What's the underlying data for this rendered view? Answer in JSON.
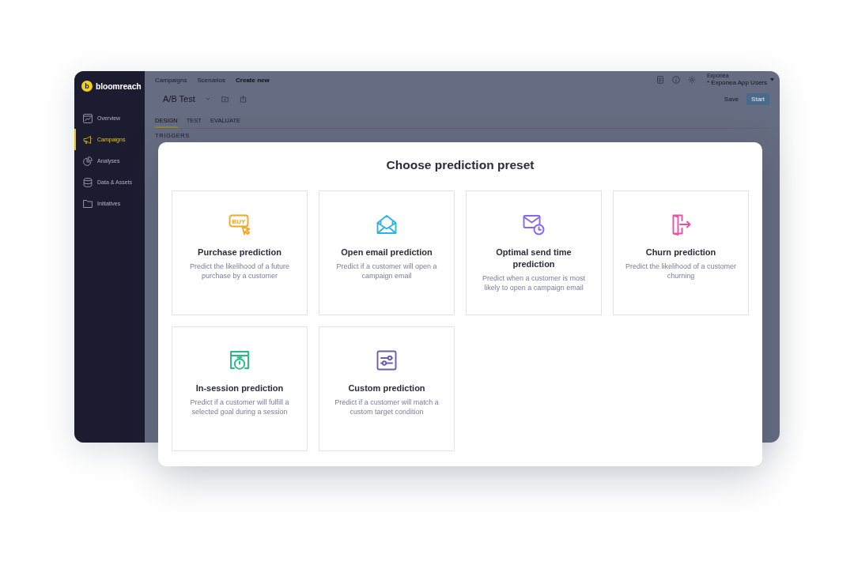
{
  "sidebar": {
    "logo_mark": "b",
    "logo": "bloomreach",
    "items": [
      {
        "kind": "overview",
        "label": "Overview",
        "selected": false
      },
      {
        "kind": "campaigns",
        "label": "Campaigns",
        "selected": true
      },
      {
        "kind": "analyses",
        "label": "Analyses",
        "selected": false
      },
      {
        "kind": "data",
        "label": "Data & Assets",
        "selected": false
      },
      {
        "kind": "initiatives",
        "label": "Initiatives",
        "selected": false
      }
    ]
  },
  "header": {
    "breadcrumbs": [
      {
        "label": "Campaigns",
        "current": false
      },
      {
        "label": "Scenarios",
        "current": false
      },
      {
        "label": "Create new",
        "current": true
      }
    ],
    "title": "A/B Test",
    "project_select": {
      "label": "Exponea",
      "value": "* Exponea App Users"
    },
    "buttons": [
      {
        "kind": "text",
        "label": "Save"
      },
      {
        "kind": "primary",
        "label": "Start"
      }
    ]
  },
  "tabs": [
    {
      "label": "DESIGN",
      "selected": true
    },
    {
      "label": "TEST",
      "selected": false
    },
    {
      "label": "EVALUATE",
      "selected": false
    }
  ],
  "section_label": "TRIGGERS",
  "modal": {
    "title": "Choose prediction preset",
    "presets": [
      {
        "kind": "buy",
        "icon_text": "BUY",
        "color": "#f5a623",
        "title": "Purchase prediction",
        "description": "Predict the likelihood of a future purchase by a customer"
      },
      {
        "kind": "open-email",
        "color": "#2fb4e0",
        "title": "Open email prediction",
        "description": "Predict if a customer will open a campaign email"
      },
      {
        "kind": "send-time",
        "color": "#8467f0",
        "title": "Optimal send time prediction",
        "description": "Predict when a customer is most likely to open a campaign email"
      },
      {
        "kind": "churn",
        "color": "#ec4ea7",
        "title": "Churn prediction",
        "description": "Predict the likelihood of a customer churning"
      },
      {
        "kind": "session",
        "color": "#22bd84",
        "title": "In-session prediction",
        "description": "Predict if a customer will fulfill a selected goal during a session"
      },
      {
        "kind": "custom",
        "color": "#6e5ea8",
        "title": "Custom prediction",
        "description": "Predict if a customer will match a custom target condition"
      }
    ]
  }
}
